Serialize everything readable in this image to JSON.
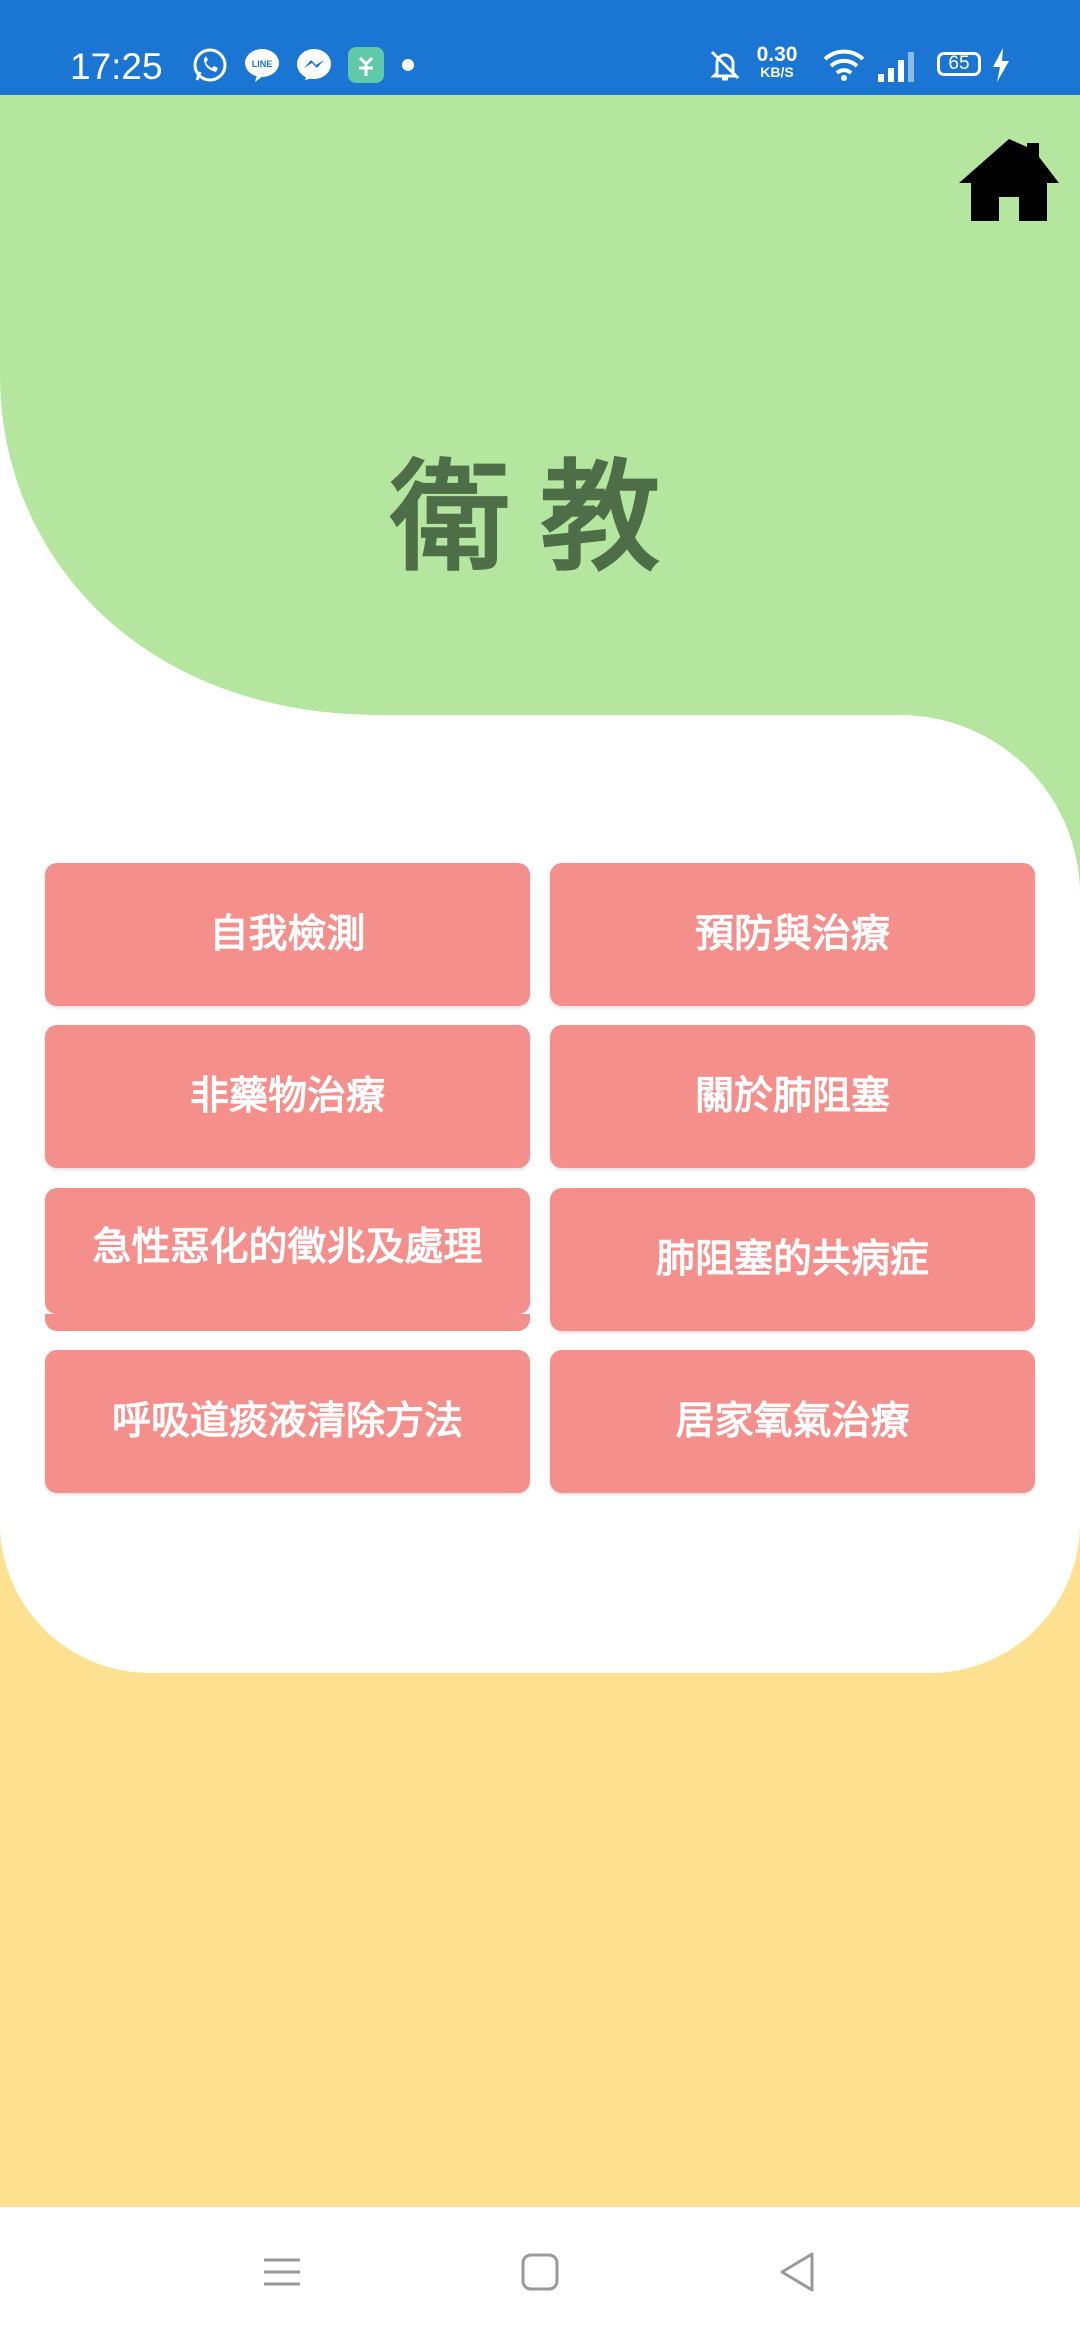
{
  "status_bar": {
    "time": "17:25",
    "net_speed_value": "0.30",
    "net_speed_unit": "KB/S",
    "battery_level": "65",
    "notification_icons": [
      "whatsapp-icon",
      "line-icon",
      "messenger-icon",
      "app-icon",
      "dot-icon"
    ],
    "system_icons": [
      "mute-bell-icon",
      "wifi-icon",
      "signal-icon",
      "battery-icon",
      "charging-icon"
    ]
  },
  "header": {
    "title": "衛教",
    "home_icon": "home-icon"
  },
  "menu": {
    "items": [
      {
        "label": "自我檢測"
      },
      {
        "label": "預防與治療"
      },
      {
        "label": "非藥物治療"
      },
      {
        "label": "關於肺阻塞"
      },
      {
        "label": "急性惡化的徵兆及處理"
      },
      {
        "label": "肺阻塞的共病症"
      },
      {
        "label": "呼吸道痰液清除方法"
      },
      {
        "label": "居家氧氣治療"
      }
    ]
  },
  "navigation_bar": {
    "icons": [
      "menu-icon",
      "home-square-icon",
      "back-icon"
    ]
  },
  "colors": {
    "status_bar": "#1a76d2",
    "green": "#b4e6a0",
    "yellow": "#fde090",
    "button": "#f48f8c",
    "title": "#4d6e47"
  }
}
